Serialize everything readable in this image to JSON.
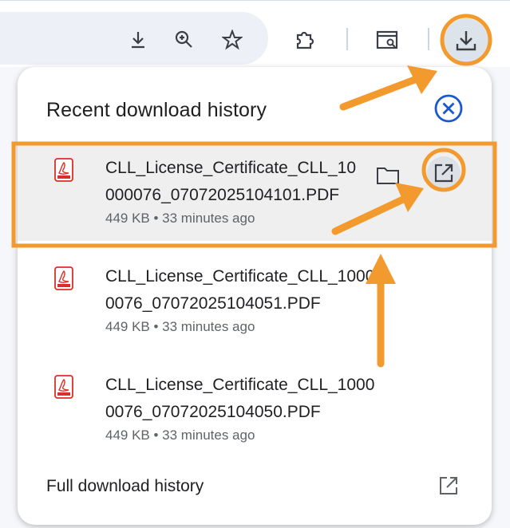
{
  "toolbar": {
    "icons": [
      "download-icon",
      "zoom-icon",
      "star-icon",
      "extensions-icon",
      "screen-search-icon",
      "downloads-icon"
    ]
  },
  "popup": {
    "title": "Recent download history",
    "items": [
      {
        "name": "CLL_License_Certificate_CLL_10000076_07072025104101.PDF",
        "meta": "449 KB • 33 minutes ago",
        "selected": true
      },
      {
        "name": "CLL_License_Certificate_CLL_10000076_07072025104051.PDF",
        "meta": "449 KB • 33 minutes ago",
        "selected": false
      },
      {
        "name": "CLL_License_Certificate_CLL_10000076_07072025104050.PDF",
        "meta": "449 KB • 33 minutes ago",
        "selected": false
      }
    ],
    "footer_label": "Full download history"
  },
  "colors": {
    "annotation": "#f39a2e",
    "close_icon": "#1a58d1",
    "pdf_icon": "#d93025"
  }
}
